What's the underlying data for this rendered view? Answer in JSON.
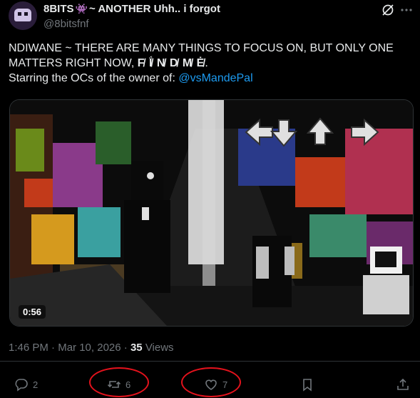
{
  "user": {
    "display_name_prefix": "8BITS",
    "alien_glyph": "👾",
    "display_name_suffix": "~ ANOTHER Uhh.. i forgot",
    "handle": "@8bitsfnf"
  },
  "tweet": {
    "line1": "NDIWANE ~ THERE ARE MANY THINGS TO FOCUS ON, BUT ONLY ONE",
    "line2_start": "MATTERS RIGHT NOW,",
    "line2_glitch": "F̸ Ḯ̸ N̸ D̸ M̸ Ė̸",
    "line2_end": ".",
    "line3_start": "Starring the OCs of the owner of:",
    "mention": "@vsMandePal"
  },
  "media": {
    "duration": "0:56"
  },
  "meta": {
    "time": "1:46 PM",
    "dot": " · ",
    "date": "Mar 10, 2026",
    "views_count": "35",
    "views_label": "Views"
  },
  "actions": {
    "replies": "2",
    "reposts": "6",
    "likes": "7"
  },
  "colors": {
    "background": "#000000",
    "text": "#e7e9ea",
    "muted": "#71767b",
    "link": "#1d9bf0",
    "annotation": "#e3121c"
  }
}
